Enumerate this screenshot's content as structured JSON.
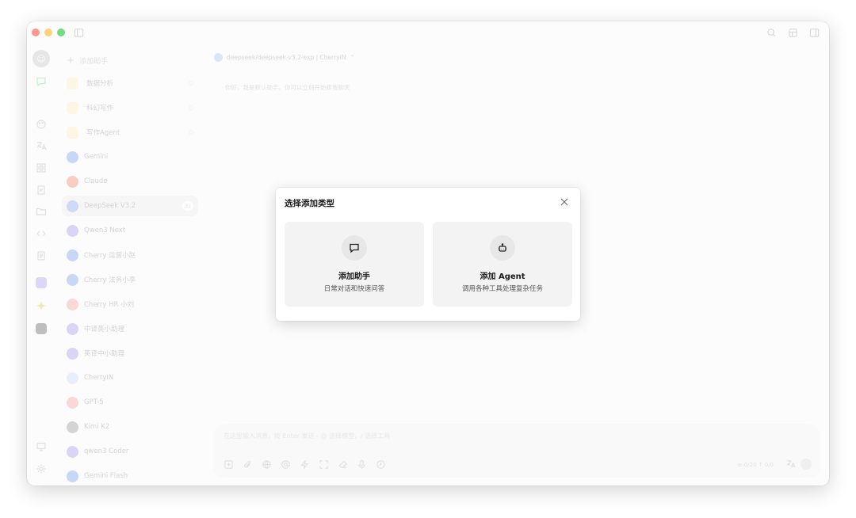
{
  "window": {
    "title_controls": [
      "close",
      "minimize",
      "zoom"
    ]
  },
  "sidebar": {
    "add_assistant_label": "添加助手",
    "items": [
      {
        "label": "数据分析",
        "icon": "emoji-icon",
        "pinned": true
      },
      {
        "label": "科幻写作",
        "icon": "emoji-icon",
        "pinned": true
      },
      {
        "label": "写作Agent",
        "icon": "emoji-icon",
        "pinned": true
      },
      {
        "label": "Gemini",
        "icon": "gemini-icon"
      },
      {
        "label": "Claude",
        "icon": "claude-icon"
      },
      {
        "label": "DeepSeek V3.2",
        "icon": "deepseek-icon",
        "count": "31",
        "active": true
      },
      {
        "label": "Qwen3 Next",
        "icon": "qwen-icon"
      },
      {
        "label": "Cherry 运营小赵",
        "icon": "gemini-icon"
      },
      {
        "label": "Cherry 法务小李",
        "icon": "gemini-icon"
      },
      {
        "label": "Cherry HR 小刘",
        "icon": "cherry-icon"
      },
      {
        "label": "中译英小助理",
        "icon": "qwen-icon"
      },
      {
        "label": "英译中小助理",
        "icon": "qwen-icon"
      },
      {
        "label": "CherryIN",
        "icon": "cherryin-icon"
      },
      {
        "label": "GPT-5",
        "icon": "cherry-icon"
      },
      {
        "label": "Kimi K2",
        "icon": "kimi-icon"
      },
      {
        "label": "qwen3 Coder",
        "icon": "qwen-icon"
      },
      {
        "label": "Gemini Flash",
        "icon": "gemini-icon"
      }
    ]
  },
  "main": {
    "model_selector": "deepseek/deepseek-v3.2-exp | CherryIN",
    "greeting": "你好，我是默认助手。你可以立刻开始跟我聊天",
    "composer": {
      "placeholder": "在这里输入消息，按 Enter 发送 - @ 选择模型，/ 选择工具",
      "counts": "≡ 0/20  ↑ 0/0"
    }
  },
  "modal": {
    "title": "选择添加类型",
    "options": [
      {
        "label": "添加助手",
        "description": "日常对话和快速问答",
        "icon": "chat-bubble-icon"
      },
      {
        "label": "添加 Agent",
        "description": "调用各种工具处理复杂任务",
        "icon": "robot-icon"
      }
    ]
  },
  "colors": {
    "traffic_red": "#fe5f57",
    "traffic_yellow": "#febc2e",
    "traffic_green": "#28c840",
    "modal_card_bg": "#f3f3f3"
  }
}
